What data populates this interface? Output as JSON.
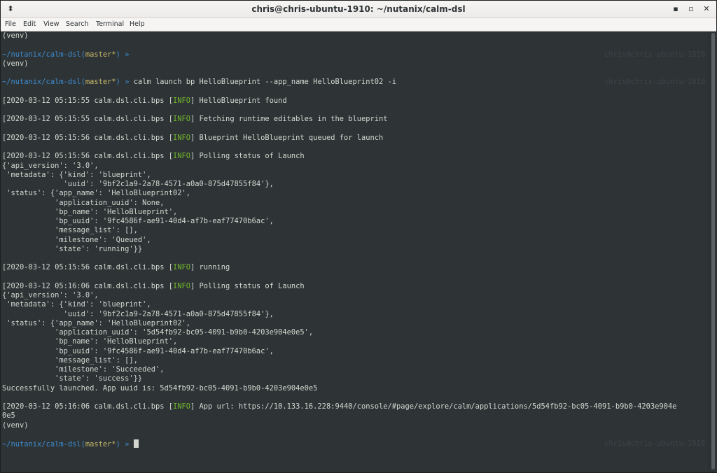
{
  "window": {
    "title": "chris@chris-ubuntu-1910: ~/nutanix/calm-dsl",
    "menu_icon": "terminal-menu-icon",
    "min_glyph": "▪",
    "max_glyph": "▫",
    "close_glyph": "✕",
    "pin_glyph": "⬍"
  },
  "menu": {
    "file": "File",
    "edit": "Edit",
    "view": "View",
    "search": "Search",
    "terminal": "Terminal",
    "help": "Help"
  },
  "prompt": {
    "path": "~/nutanix/calm-dsl",
    "branch_open": "(",
    "branch": "master*",
    "branch_close": ")",
    "arrow": " »",
    "right_prompt": "chris@chris-ubuntu-1910"
  },
  "terminal": {
    "venv": "(venv)",
    "command": " calm launch bp HelloBlueprint --app_name HelloBlueprint02 -i",
    "info": "INFO",
    "log": {
      "l1_ts": "[2020-03-12 05:15:55 calm.dsl.cli.bps [",
      "l1_msg": "] HelloBlueprint found",
      "l2_ts": "[2020-03-12 05:15:55 calm.dsl.cli.bps [",
      "l2_msg": "] Fetching runtime editables in the blueprint",
      "l3_ts": "[2020-03-12 05:15:56 calm.dsl.cli.bps [",
      "l3_msg": "] Blueprint HelloBlueprint queued for launch",
      "l4_ts": "[2020-03-12 05:15:56 calm.dsl.cli.bps [",
      "l4_msg": "] Polling status of Launch",
      "l5_ts": "[2020-03-12 05:15:56 calm.dsl.cli.bps [",
      "l5_msg": "] running",
      "l6_ts": "[2020-03-12 05:16:06 calm.dsl.cli.bps [",
      "l6_msg": "] Polling status of Launch",
      "l7_ts": "[2020-03-12 05:16:06 calm.dsl.cli.bps [",
      "l7_msg": "] App url: https://10.133.16.228:9440/console/#page/explore/calm/applications/5d54fb92-bc05-4091-b9b0-4203e904e",
      "l7_wrap": "0e5"
    },
    "block1": [
      "{'api_version': '3.0',",
      " 'metadata': {'kind': 'blueprint',",
      "              'uuid': '9bf2c1a9-2a78-4571-a0a0-875d47855f84'},",
      " 'status': {'app_name': 'HelloBlueprint02',",
      "            'application_uuid': None,",
      "            'bp_name': 'HelloBlueprint',",
      "            'bp_uuid': '9fc4586f-ae91-40d4-af7b-eaf77470b6ac',",
      "            'message_list': [],",
      "            'milestone': 'Queued',",
      "            'state': 'running'}}"
    ],
    "block2": [
      "{'api_version': '3.0',",
      " 'metadata': {'kind': 'blueprint',",
      "              'uuid': '9bf2c1a9-2a78-4571-a0a0-875d47855f84'},",
      " 'status': {'app_name': 'HelloBlueprint02',",
      "            'application_uuid': '5d54fb92-bc05-4091-b9b0-4203e904e0e5',",
      "            'bp_name': 'HelloBlueprint',",
      "            'bp_uuid': '9fc4586f-ae91-40d4-af7b-eaf77470b6ac',",
      "            'message_list': [],",
      "            'milestone': 'Succeeded',",
      "            'state': 'success'}}"
    ],
    "success": "Successfully launched. App uuid is: 5d54fb92-bc05-4091-b9b0-4203e904e0e5"
  },
  "colors": {
    "background": "#2e3436",
    "text": "#d3d7cf",
    "prompt_path": "#3c8bd0",
    "branch": "#c8b86a",
    "info": "#72b82a"
  }
}
